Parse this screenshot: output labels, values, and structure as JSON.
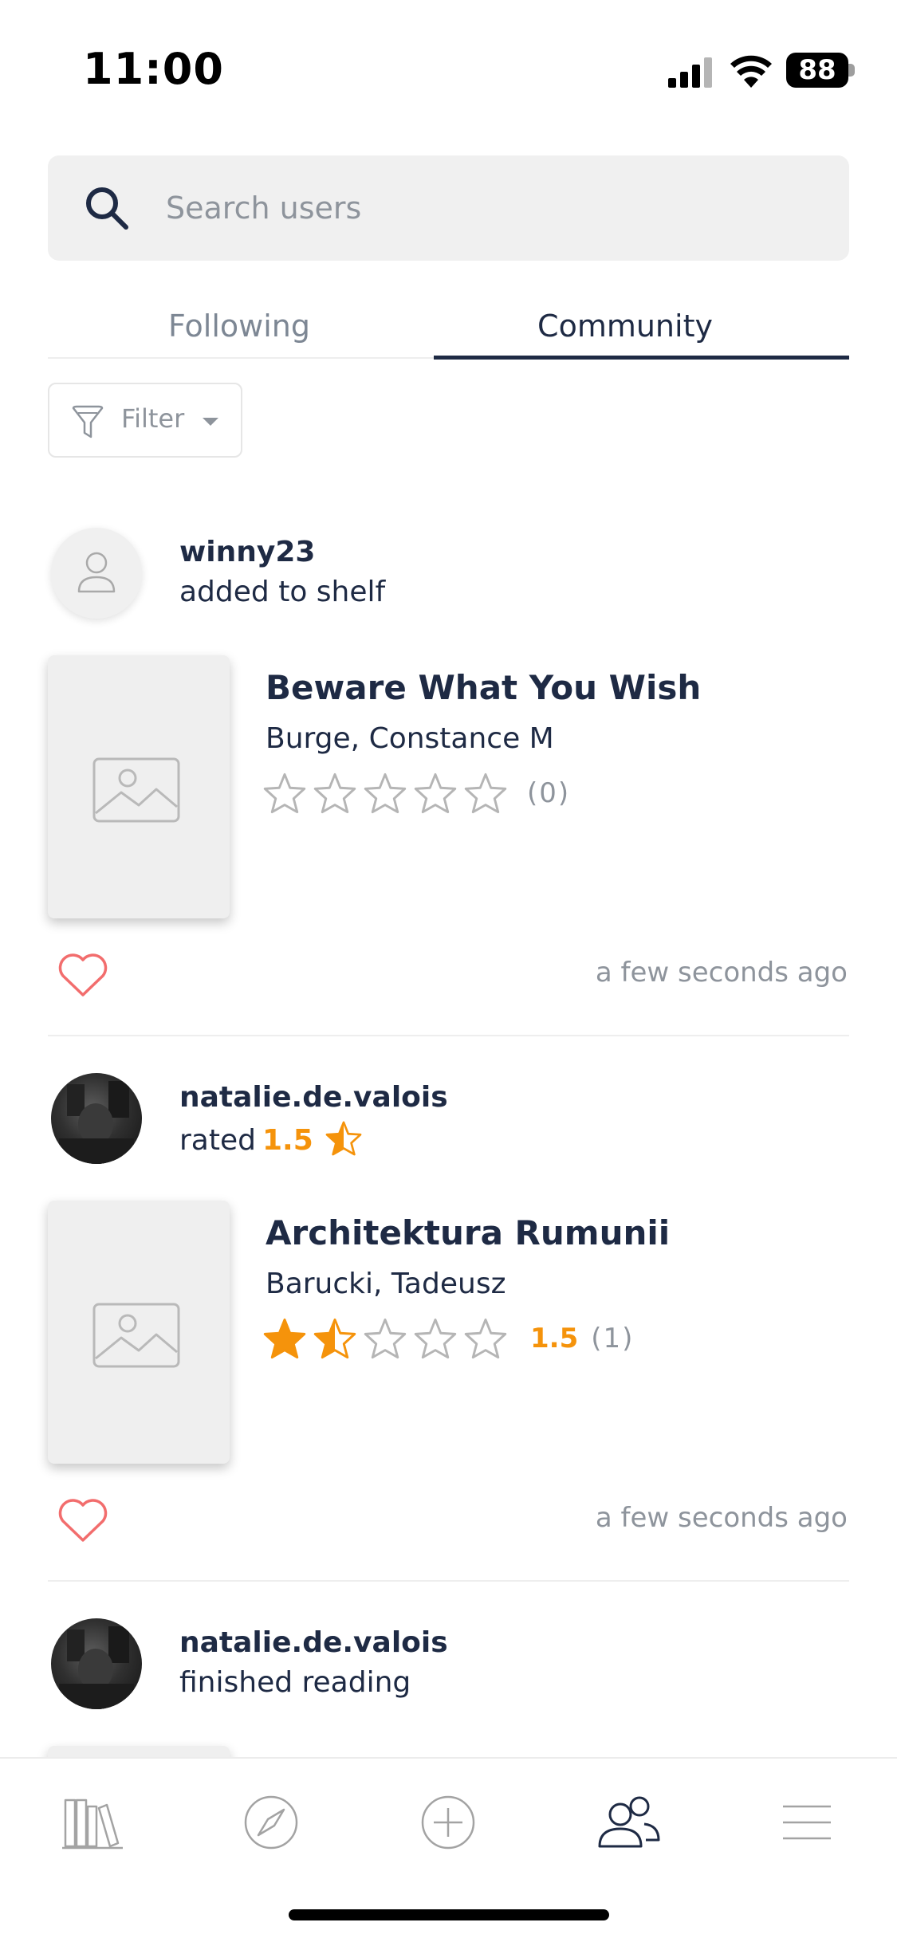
{
  "status_bar": {
    "time": "11:00",
    "battery": "88"
  },
  "search": {
    "placeholder": "Search users"
  },
  "tabs": [
    {
      "label": "Following",
      "active": false
    },
    {
      "label": "Community",
      "active": true
    }
  ],
  "filter": {
    "label": "Filter"
  },
  "feed": [
    {
      "username": "winny23",
      "action": "added to shelf",
      "book": {
        "title": "Beware What You Wish",
        "author": "Burge, Constance  M",
        "rating_count": "(0)",
        "rating": 0
      },
      "timestamp": "a few seconds ago"
    },
    {
      "username": "natalie.de.valois",
      "action": "rated",
      "action_rating": "1.5",
      "book": {
        "title": "Architektura Rumunii",
        "author": "Barucki, Tadeusz",
        "avg_rating": "1.5",
        "rating_count": "(1)",
        "rating": 1.5
      },
      "timestamp": "a few seconds ago"
    },
    {
      "username": "natalie.de.valois",
      "action": "finished reading"
    }
  ],
  "bottom_nav": [
    "library-icon",
    "compass-icon",
    "add-icon",
    "community-icon",
    "menu-icon"
  ],
  "colors": {
    "accent": "#f5930b",
    "primary": "#1e2a44",
    "heart": "#f26d6d",
    "muted": "#8e949c"
  }
}
